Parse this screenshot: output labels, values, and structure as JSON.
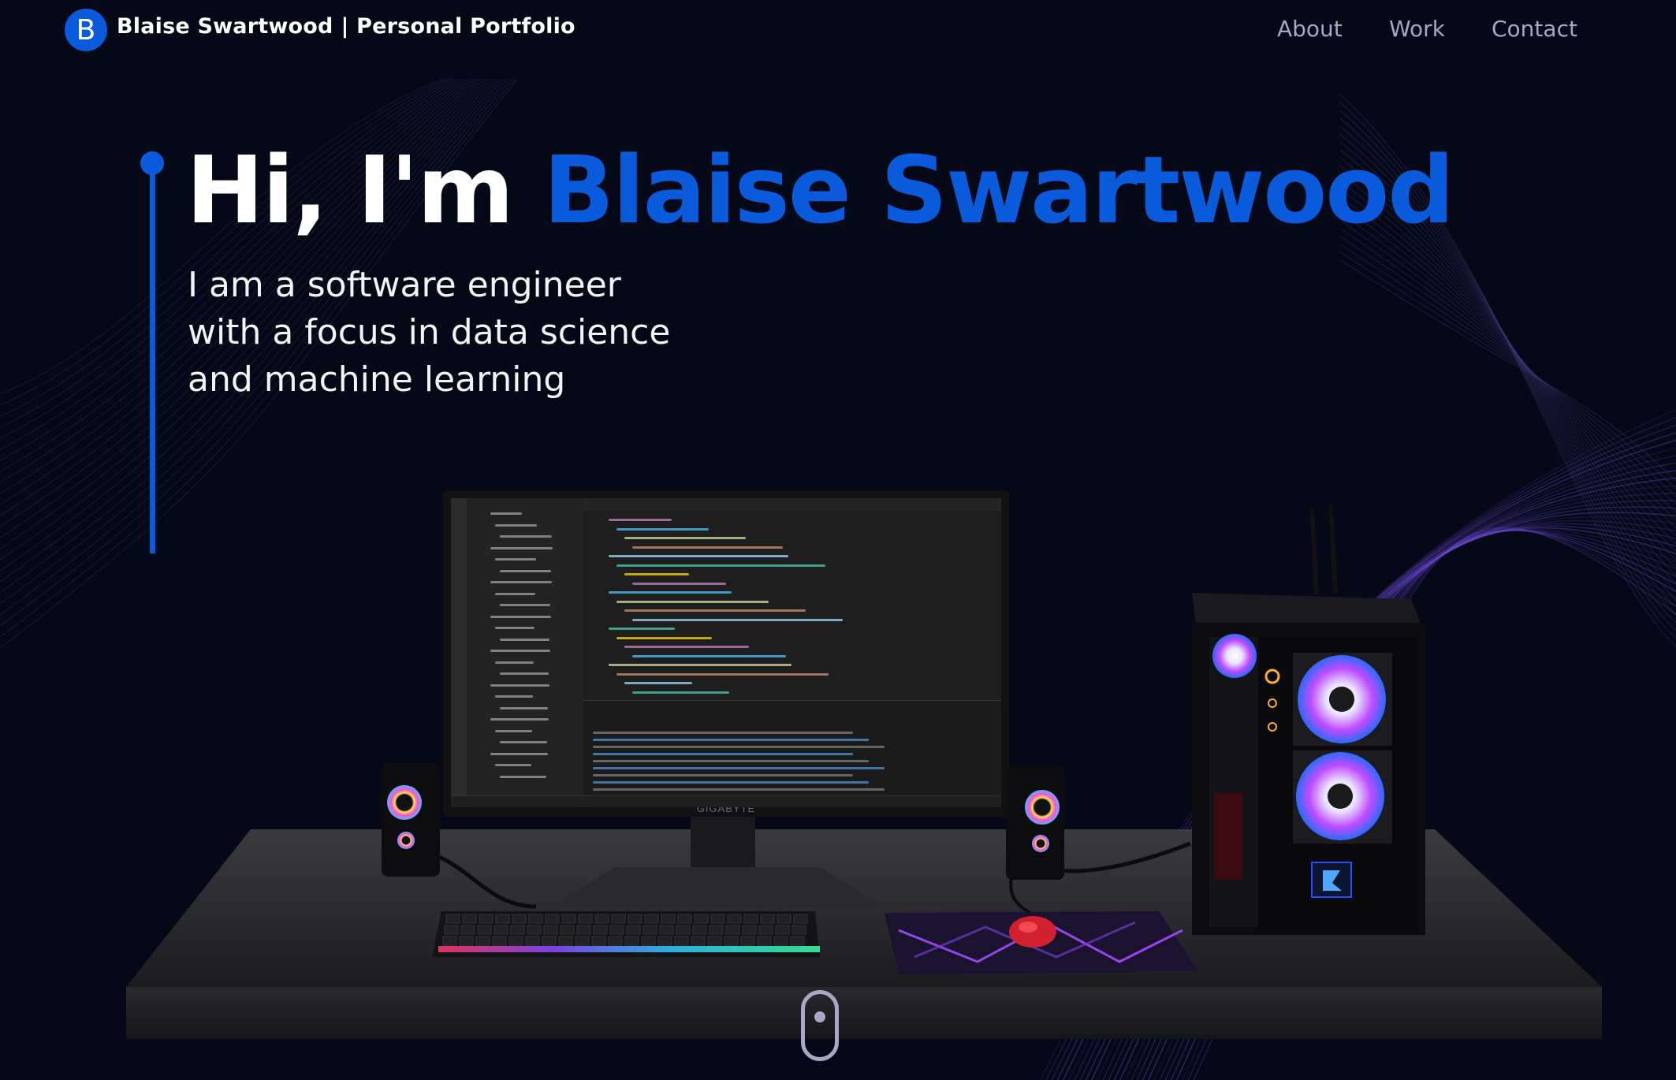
{
  "brand": {
    "logo_letter": "B",
    "name": "Blaise Swartwood",
    "suffix": "| Personal Portfolio"
  },
  "nav": {
    "items": [
      {
        "label": "About"
      },
      {
        "label": "Work"
      },
      {
        "label": "Contact"
      }
    ]
  },
  "hero": {
    "greeting": "Hi, I'm ",
    "name": "Blaise Swartwood",
    "subtitle_lines": [
      "I am a software engineer",
      "with a focus in data science",
      "and machine learning"
    ]
  },
  "scene": {
    "monitor_brand": "GIGABYTE"
  },
  "colors": {
    "background": "#050816",
    "accent": "#0a5bdc",
    "nav_text": "#aaa6c3",
    "wave": "#6f4bd8"
  },
  "icons": {
    "scroll": "mouse-scroll-icon"
  }
}
